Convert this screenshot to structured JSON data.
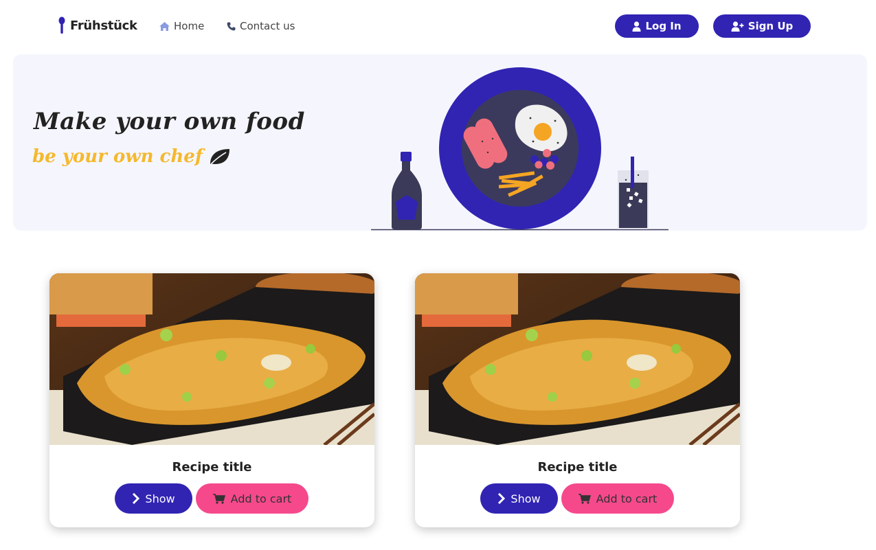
{
  "navbar": {
    "brand": "Frühstück",
    "links": [
      {
        "label": "Home",
        "icon": "home-icon"
      },
      {
        "label": "Contact us",
        "icon": "phone-icon"
      }
    ],
    "login_label": "Log In",
    "signup_label": "Sign Up"
  },
  "hero": {
    "title": "Make your own food",
    "subtitle": "be your own chef",
    "subtitle_icon": "leaf-icon"
  },
  "cards": [
    {
      "title": "Recipe title",
      "show_label": "Show",
      "cart_label": "Add to cart"
    },
    {
      "title": "Recipe title",
      "show_label": "Show",
      "cart_label": "Add to cart"
    }
  ],
  "colors": {
    "primary": "#3124b3",
    "accent": "#f5498c",
    "highlight": "#f5b82e",
    "hero_bg": "#f5f6fd"
  }
}
